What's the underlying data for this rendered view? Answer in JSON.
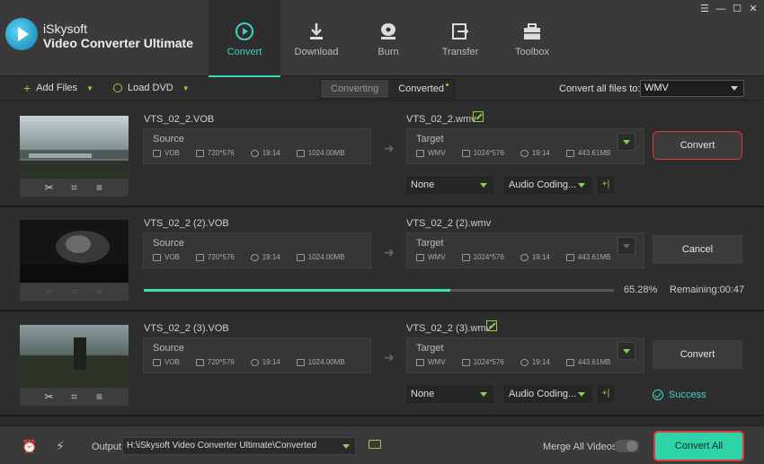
{
  "app": {
    "brand_line1": "iSkysoft",
    "brand_line2": "Video Converter Ultimate"
  },
  "nav": [
    {
      "label": "Convert",
      "icon": "convert-icon",
      "active": true
    },
    {
      "label": "Download",
      "icon": "download-icon"
    },
    {
      "label": "Burn",
      "icon": "burn-icon"
    },
    {
      "label": "Transfer",
      "icon": "transfer-icon"
    },
    {
      "label": "Toolbox",
      "icon": "toolbox-icon"
    }
  ],
  "toolbar": {
    "add_files": "Add Files",
    "load_dvd": "Load DVD",
    "tab_converting": "Converting",
    "tab_converted": "Converted",
    "convert_all_to": "Convert all files to:",
    "format": "WMV"
  },
  "rows": [
    {
      "source_name": "VTS_02_2.VOB",
      "source": {
        "title": "Source",
        "format": "VOB",
        "resolution": "720*576",
        "duration": "19:14",
        "size": "1024.00MB"
      },
      "target_name": "VTS_02_2.wmv",
      "target": {
        "title": "Target",
        "format": "WMV",
        "resolution": "1024*576",
        "duration": "19:14",
        "size": "443.61MB"
      },
      "subtitle": "None",
      "audio": "Audio Coding...",
      "action": "Convert"
    },
    {
      "source_name": "VTS_02_2 (2).VOB",
      "source": {
        "title": "Source",
        "format": "VOB",
        "resolution": "720*576",
        "duration": "19:14",
        "size": "1024.00MB"
      },
      "target_name": "VTS_02_2 (2).wmv",
      "target": {
        "title": "Target",
        "format": "WMV",
        "resolution": "1024*576",
        "duration": "19:14",
        "size": "443.61MB"
      },
      "action": "Cancel",
      "progress": 0.6528,
      "progress_text": "65.28%",
      "remaining": "Remaining:00:47"
    },
    {
      "source_name": "VTS_02_2 (3).VOB",
      "source": {
        "title": "Source",
        "format": "VOB",
        "resolution": "720*576",
        "duration": "19:14",
        "size": "1024.00MB"
      },
      "target_name": "VTS_02_2 (3).wmv",
      "target": {
        "title": "Target",
        "format": "WMV",
        "resolution": "1024*576",
        "duration": "19:14",
        "size": "443.61MB"
      },
      "subtitle": "None",
      "audio": "Audio Coding...",
      "action": "Convert",
      "status": "Success"
    }
  ],
  "footer": {
    "output_label": "Output",
    "output_path": "H:\\iSkysoft Video Converter Ultimate\\Converted",
    "merge_label": "Merge All Videos",
    "convert_all": "Convert All"
  },
  "colors": {
    "accent": "#3fd1c4",
    "green": "#8dd04a",
    "highlight": "#e0393e",
    "convert_all_bg": "#2ed3a8"
  }
}
